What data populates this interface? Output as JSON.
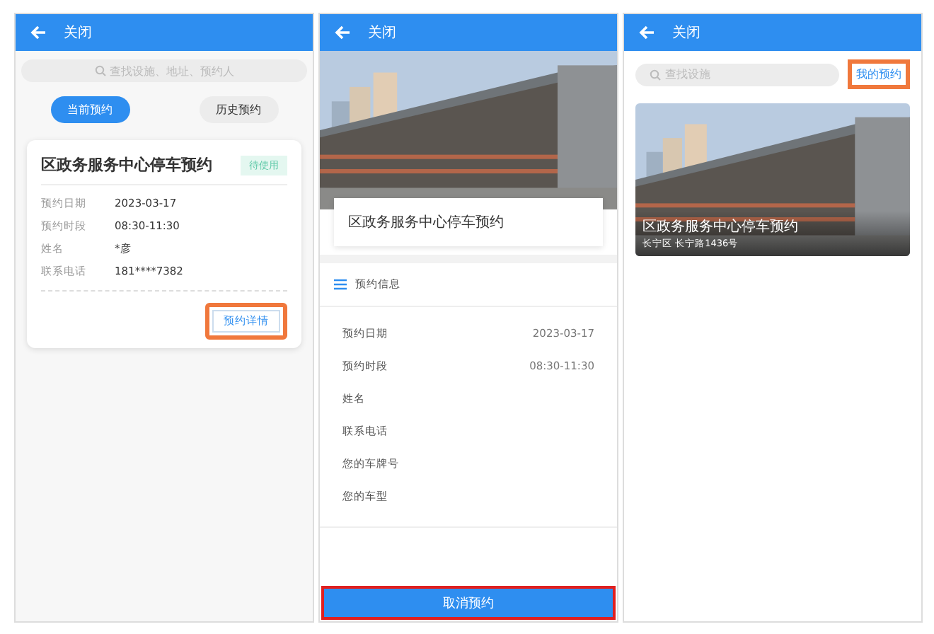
{
  "screens": [
    {
      "kind": "list",
      "header": {
        "back": "关闭"
      },
      "search": {
        "placeholder": "查找设施、地址、预约人"
      },
      "tabs": [
        {
          "label": "当前预约",
          "selected": true
        },
        {
          "label": "历史预约",
          "selected": false
        }
      ],
      "card": {
        "title": "区政务服务中心停车预约",
        "status": "待使用",
        "rows": [
          {
            "label": "预约日期",
            "value": "2023-03-17"
          },
          {
            "label": "预约时段",
            "value": "08:30-11:30"
          },
          {
            "label": "姓名",
            "value": "*彦"
          },
          {
            "label": "联系电话",
            "value": "181****7382"
          }
        ],
        "button": {
          "label": "预约详情",
          "highlighted": true
        }
      }
    },
    {
      "kind": "detail",
      "header": {
        "back": "关闭"
      },
      "title": "区政务服务中心停车预约",
      "section": "预约信息",
      "rows": [
        {
          "label": "预约日期",
          "value": "2023-03-17"
        },
        {
          "label": "预约时段",
          "value": "08:30-11:30"
        },
        {
          "label": "姓名"
        },
        {
          "label": "联系电话"
        },
        {
          "label": "您的车牌号"
        },
        {
          "label": "您的车型"
        }
      ],
      "button": {
        "label": "取消预约",
        "highlighted": true
      }
    },
    {
      "kind": "facilities",
      "header": {
        "back": "关闭"
      },
      "search": {
        "placeholder": "查找设施"
      },
      "link": {
        "label": "我的预约",
        "highlighted": true
      },
      "facility": {
        "title": "区政务服务中心停车预约",
        "address": "长宁区 长宁路1436号"
      }
    }
  ]
}
